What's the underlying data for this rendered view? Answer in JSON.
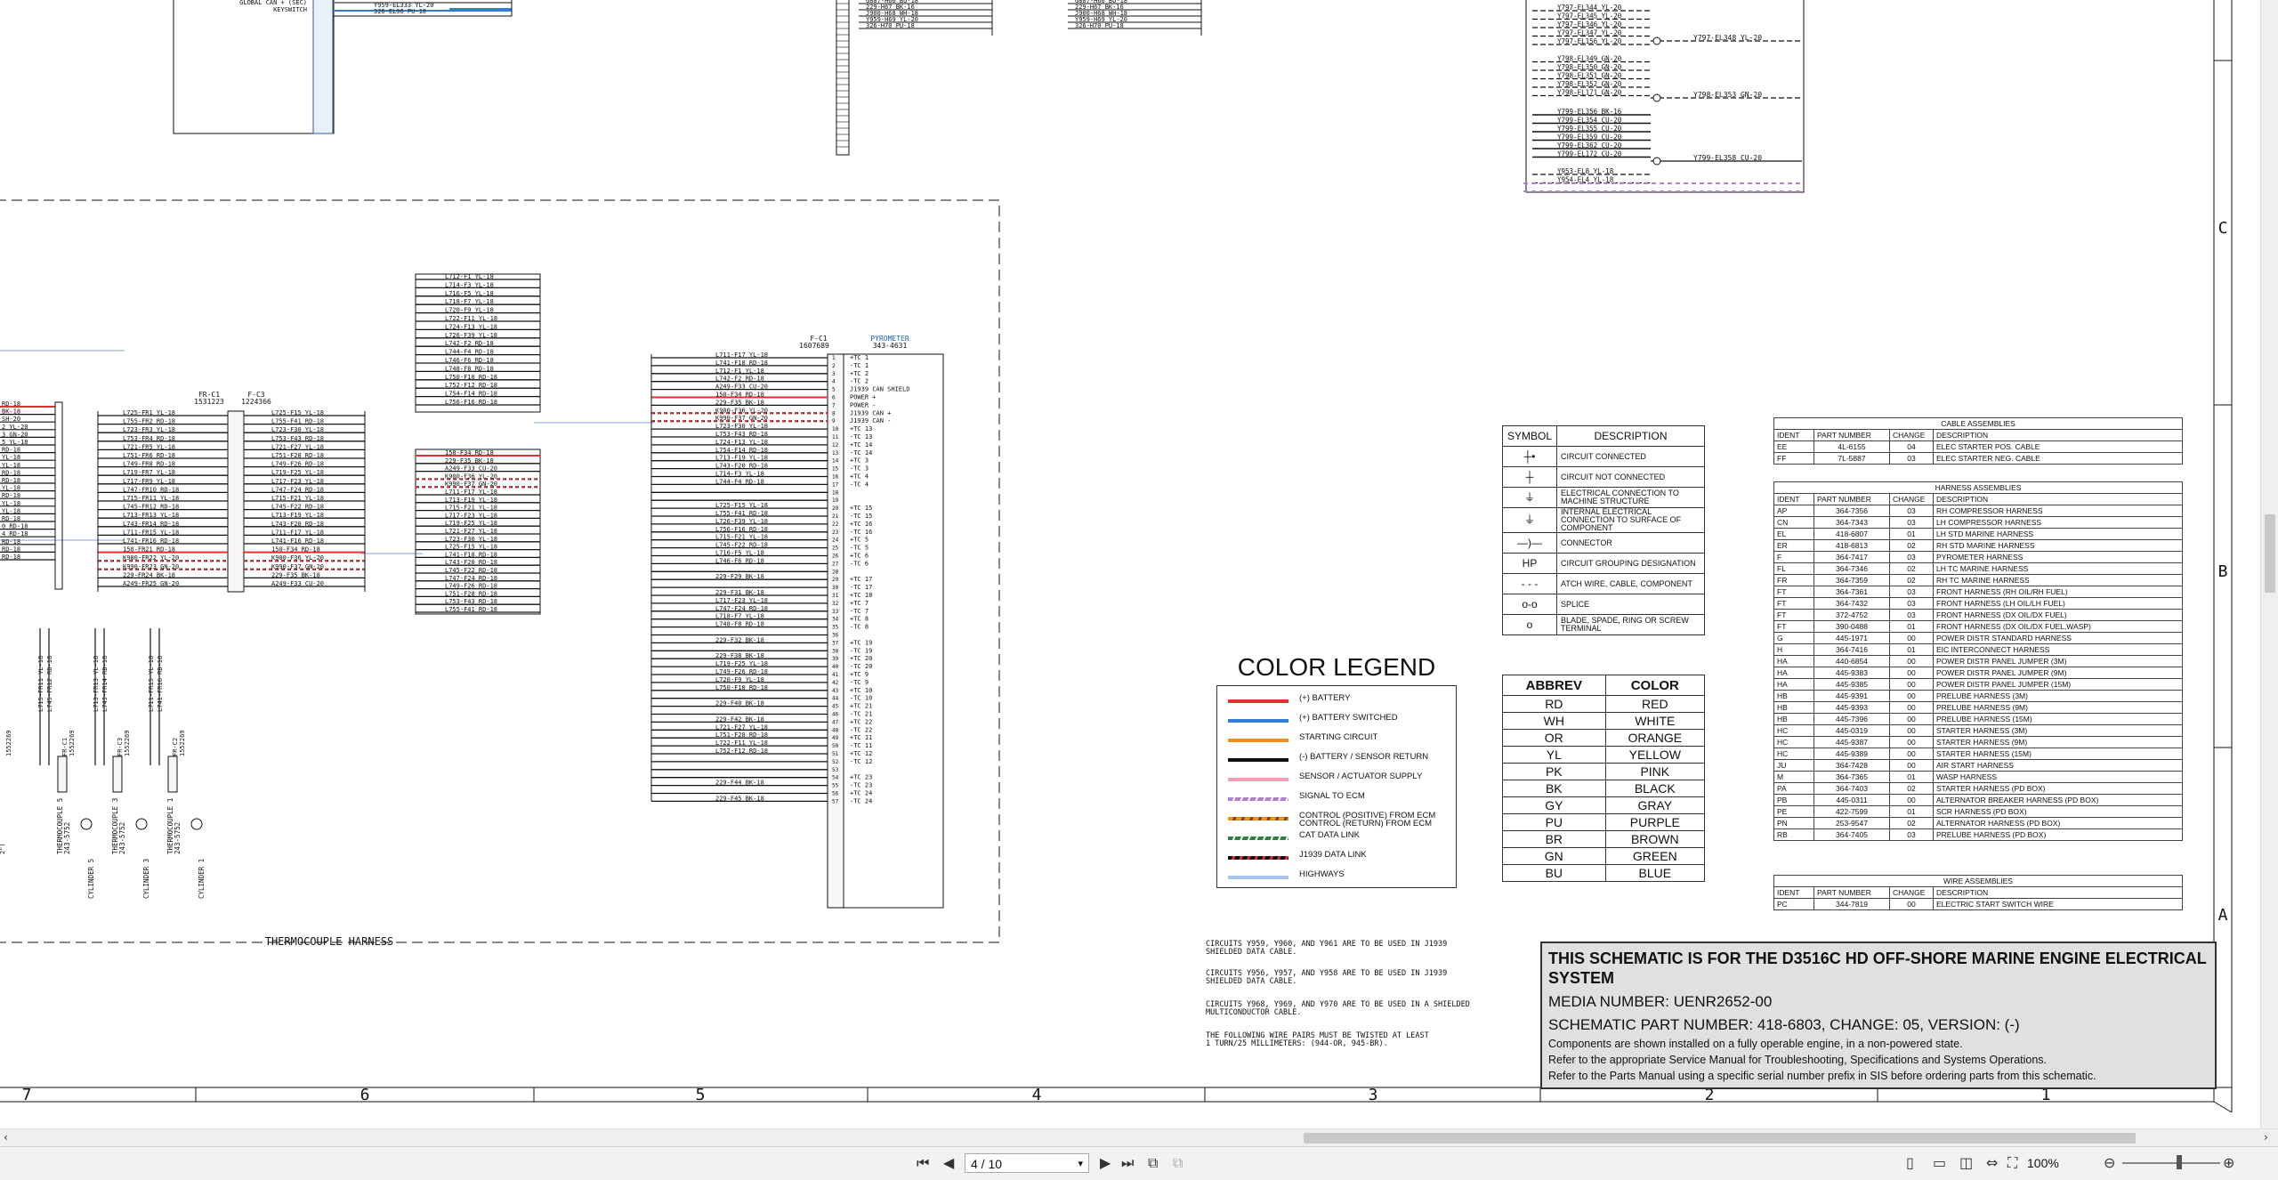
{
  "schematic": {
    "top_left_labels": [
      "GLOBAL CAN + (SEC)",
      "KEYSWITCH"
    ],
    "top_left_wires": [
      "Y959-EL333 YL-20",
      "326-EL96 PU-18"
    ],
    "top_mid_wires_a": [
      "G807-H66 BU-18",
      "229-H67 BK-16",
      "J900-H68 WH-18",
      "Y959-H69 YL-20",
      "326-H70 PU-18"
    ],
    "top_mid_wires_b": [
      "G807-H66 BU-18",
      "229-H67 BK-16",
      "J900-H68 WH-18",
      "Y959-H69 YL-20",
      "326-H70 PU-18"
    ],
    "top_right_wires": [
      "Y797-EL344 YL-20",
      "Y797-EL345 YL-20",
      "Y797-EL346 YL-20",
      "Y797-EL347 YL-20",
      "Y797-EL156 YL-20",
      "Y798-EL349 GN-20",
      "Y798-EL350 GN-20",
      "Y798-EL351 GN-20",
      "Y798-EL352 GN-20",
      "Y798-EL171 GN-20",
      "Y799-EL356 BK-16",
      "Y799-EL354 CU-20",
      "Y799-EL355 CU-20",
      "Y799-EL359 CU-20",
      "Y799-EL362 CU-20",
      "Y799-EL172 CU-20",
      "Y953-EL8 YL-18",
      "Y954-EL4 YL-18"
    ],
    "top_right_splices": [
      "Y797-EL348 YL-20",
      "Y798-EL353 GN-20",
      "Y799-EL358 CU-20"
    ],
    "connector_fr": {
      "name": "FR-C1",
      "part": "1531223"
    },
    "connector_f3": {
      "name": "F-C3",
      "part": "1224366"
    },
    "connector_fc1": {
      "name": "F-C1",
      "part": "1607689"
    },
    "pyrometer": {
      "name": "PYROMETER",
      "part": "343-4631"
    },
    "fr_left_wires": [
      "L725-FR1 YL-18",
      "L755-FR2 RD-18",
      "L723-FR3 YL-18",
      "L753-FR4 RD-18",
      "L721-FR5 YL-18",
      "L751-FR6 RD-18",
      "L749-FR8 RD-18",
      "L719-FR7 YL-18",
      "L717-FR9 YL-18",
      "L747-FR10 RD-18",
      "L715-FR11 YL-18",
      "L745-FR12 RD-18",
      "L713-FR13 YL-18",
      "L743-FR14 RD-18",
      "L711-FR15 YL-18",
      "L741-FR16 RD-18",
      "150-FR21 RD-18",
      "K900-FR22 YL-20",
      "K990-FR23 GN-20",
      "229-FR24 BK-18",
      "A249-FR25 GN-20"
    ],
    "fr_right_wires": [
      "L725-F15 YL-18",
      "L755-F41 RD-18",
      "L723-F30 YL-18",
      "L753-F43 RD-18",
      "L721-F27 YL-18",
      "L751-F28 RD-18",
      "L749-F26 RD-18",
      "L719-F25 YL-18",
      "L717-F23 YL-18",
      "L747-F24 RD-18",
      "L715-F21 YL-18",
      "L745-F22 RD-18",
      "L713-F19 YL-18",
      "L743-F20 RD-18",
      "L711-F17 YL-18",
      "L741-F16 RD-18",
      "150-F34 RD-18",
      "K900-F36 YL-20",
      "K990-F37 GN-20",
      "229-F35 BK-18",
      "A249-F33 CU-20"
    ],
    "mid_wires_a": [
      "L712-F1 YL-18",
      "L714-F3 YL-18",
      "L716-F5 YL-18",
      "L718-F7 YL-18",
      "L720-F9 YL-18",
      "L722-F11 YL-18",
      "L724-F13 YL-18",
      "L726-F39 YL-18",
      "L742-F2 RD-18",
      "L744-F4 RD-18",
      "L746-F6 RD-18",
      "L748-F8 RD-18",
      "L750-F10 RD-18",
      "L752-F12 RD-18",
      "L754-F14 RD-18",
      "L756-F16 RD-18"
    ],
    "mid_wires_b": [
      "150-F34 RD-18",
      "229-F35 BK-18",
      "A249-F33 CU-20",
      "K900-F36 YL-20",
      "K990-F37 GN-20",
      "L711-F17 YL-18",
      "L713-F19 YL-18",
      "L715-F21 YL-18",
      "L717-F23 YL-18",
      "L719-F25 YL-18",
      "L721-F27 YL-18",
      "L723-F30 YL-18",
      "L725-F15 YL-18",
      "L741-F18 RD-18",
      "L743-F20 RD-18",
      "L745-F22 RD-18",
      "L747-F24 RD-18",
      "L749-F26 RD-18",
      "L751-F28 RD-18",
      "L753-F43 RD-18",
      "L755-F41 RD-18"
    ],
    "fc1_wires": [
      "L711-F17 YL-18",
      "L741-F18 RD-18",
      "L712-F1 YL-18",
      "L742-F2 RD-18",
      "A249-F33 CU-20",
      "150-F34 RD-18",
      "229-F35 BK-18",
      "K900-F36 YL-20",
      "K990-F37 GN-20",
      "L723-F30 YL-18",
      "L753-F43 RD-18",
      "L724-F13 YL-18",
      "L754-F14 RD-18",
      "L713-F19 YL-18",
      "L743-F20 RD-18",
      "L714-F3 YL-18",
      "L744-F4 RD-18",
      "",
      "",
      "L725-F15 YL-18",
      "L755-F41 RD-18",
      "L726-F39 YL-18",
      "L756-F16 RD-18",
      "L715-F21 YL-18",
      "L745-F22 RD-18",
      "L716-F5 YL-18",
      "L746-F6 RD-18",
      "",
      "229-F29 BK-18",
      "",
      "229-F31 BK-18",
      "L717-F23 YL-18",
      "L747-F24 RD-18",
      "L718-F7 YL-18",
      "L748-F8 RD-18",
      "",
      "229-F32 BK-18",
      "",
      "229-F38 BK-18",
      "L719-F25 YL-18",
      "L749-F26 RD-18",
      "L720-F9 YL-18",
      "L750-F10 RD-18",
      "",
      "229-F40 BK-18",
      "",
      "229-F42 BK-18",
      "L721-F27 YL-18",
      "L751-F28 RD-18",
      "L722-F11 YL-18",
      "L752-F12 RD-18",
      "",
      "",
      "",
      "229-F44 BK-18",
      "",
      "229-F45 BK-18"
    ],
    "fc1_pin_labels": [
      "+TC 1",
      "-TC 1",
      "+TC 2",
      "-TC 2",
      "J1939 CAN SHIELD",
      "POWER +",
      "POWER -",
      "J1939 CAN +",
      "J1939 CAN -",
      "+TC 13",
      "-TC 13",
      "+TC 14",
      "-TC 14",
      "+TC 3",
      "-TC 3",
      "+TC 4",
      "-TC 4",
      "",
      "",
      "+TC 15",
      "-TC 15",
      "+TC 16",
      "-TC 16",
      "+TC 5",
      "-TC 5",
      "+TC 6",
      "-TC 6",
      "",
      "+TC 17",
      "-TC 17",
      "+TC 18",
      "+TC 7",
      "-TC 7",
      "+TC 8",
      "-TC 8",
      "",
      "+TC 19",
      "-TC 19",
      "+TC 20",
      "-TC 20",
      "+TC 9",
      "-TC 9",
      "+TC 10",
      "-TC 10",
      "+TC 21",
      "-TC 21",
      "+TC 22",
      "-TC 22",
      "+TC 11",
      "-TC 11",
      "+TC 12",
      "-TC 12",
      "",
      "+TC 23",
      "-TC 23",
      "+TC 24",
      "-TC 24"
    ],
    "left_wires": [
      "RD-18",
      "BK-18",
      "SH-20",
      "2 YL-20",
      "3 GN-20",
      "5 YL-18",
      "RD-18",
      "YL-18",
      "YL-18",
      "RD-18",
      "RD-18",
      "YL-18",
      "RD-18",
      "YL-18",
      "YL-18",
      "RD-18",
      "0 RD-18",
      "4 RD-18",
      "RD-18",
      "RD-18",
      "RD-18"
    ],
    "thermocouples": [
      {
        "name": "THERMOCOUPLE 5",
        "part": "243-5752",
        "cyl": "CYLINDER 5",
        "conn": "FR-C1",
        "conn_part": "1552269",
        "wires": [
          "L715-FR11 YL-18",
          "L745-FR12 RD-18"
        ]
      },
      {
        "name": "THERMOCOUPLE 3",
        "part": "243-5752",
        "cyl": "CYLINDER 3",
        "conn": "FR-C3",
        "conn_part": "1552269",
        "wires": [
          "L713-FR13 YL-18",
          "L743-FR14 RD-18"
        ]
      },
      {
        "name": "THERMOCOUPLE 1",
        "part": "243-5752",
        "cyl": "CYLINDER 1",
        "conn": "FR-C2",
        "conn_part": "1552269",
        "wires": [
          "L711-FR15 YL-18",
          "L741-FR16 RD-18"
        ]
      }
    ],
    "left_cut_labels": [
      "2\")",
      "1552269"
    ],
    "harness_label": "THERMOCOUPLE HARNESS"
  },
  "zones": {
    "columns": [
      "7",
      "6",
      "5",
      "4",
      "3",
      "2",
      "1"
    ],
    "rows": [
      "C",
      "B",
      "A"
    ]
  },
  "colors": {
    "battery": "#e03030",
    "battery_switched": "#2f7fd6",
    "starting": "#f0901c",
    "return": "#111111",
    "sensor_supply": "#f4a0b4",
    "signal": "#b080d0",
    "cat_data": "#2f7f3f",
    "highways": "#a8c4e8",
    "title_bg": "#e0e0e0"
  },
  "symbol_table": {
    "headers": [
      "SYMBOL",
      "DESCRIPTION"
    ],
    "rows": [
      {
        "icon": "circuit-connected-icon",
        "glyph": "┼•",
        "desc": "CIRCUIT CONNECTED"
      },
      {
        "icon": "circuit-not-connected-icon",
        "glyph": "┼",
        "desc": "CIRCUIT NOT CONNECTED"
      },
      {
        "icon": "ground-machine-icon",
        "glyph": "⏚",
        "desc": "ELECTRICAL CONNECTION TO MACHINE STRUCTURE"
      },
      {
        "icon": "ground-component-icon",
        "glyph": "⏚",
        "desc": "INTERNAL ELECTRICAL CONNECTION TO SURFACE OF COMPONENT"
      },
      {
        "icon": "connector-icon",
        "glyph": "—)—",
        "desc": "CONNECTOR"
      },
      {
        "icon": "circuit-grouping-icon",
        "glyph": "HP",
        "desc": "CIRCUIT GROUPING DESIGNATION"
      },
      {
        "icon": "attach-wire-icon",
        "glyph": "- - -",
        "desc": "ATCH WIRE, CABLE, COMPONENT"
      },
      {
        "icon": "splice-icon",
        "glyph": "o-o",
        "desc": "SPLICE"
      },
      {
        "icon": "terminal-icon",
        "glyph": "o",
        "desc": "BLADE, SPADE, RING OR SCREW TERMINAL"
      }
    ]
  },
  "abbrev_table": {
    "headers": [
      "ABBREV",
      "COLOR"
    ],
    "rows": [
      [
        "RD",
        "RED"
      ],
      [
        "WH",
        "WHITE"
      ],
      [
        "OR",
        "ORANGE"
      ],
      [
        "YL",
        "YELLOW"
      ],
      [
        "PK",
        "PINK"
      ],
      [
        "BK",
        "BLACK"
      ],
      [
        "GY",
        "GRAY"
      ],
      [
        "PU",
        "PURPLE"
      ],
      [
        "BR",
        "BROWN"
      ],
      [
        "GN",
        "GREEN"
      ],
      [
        "BU",
        "BLUE"
      ]
    ]
  },
  "color_legend": {
    "title": "COLOR LEGEND",
    "items": [
      {
        "label": "(+) BATTERY",
        "style": "battery"
      },
      {
        "label": "(+) BATTERY SWITCHED",
        "style": "battery_switched"
      },
      {
        "label": "STARTING CIRCUIT",
        "style": "starting"
      },
      {
        "label": "(-) BATTERY / SENSOR RETURN",
        "style": "return"
      },
      {
        "label": "SENSOR / ACTUATOR SUPPLY",
        "style": "sensor_supply"
      },
      {
        "label": "SIGNAL TO ECM",
        "style": "signal_dash"
      },
      {
        "label": "CONTROL (POSITIVE) FROM ECM\nCONTROL (RETURN) FROM ECM",
        "style": "control"
      },
      {
        "label": "CAT DATA LINK",
        "style": "cat_dash"
      },
      {
        "label": "J1939 DATA LINK",
        "style": "j1939_dash"
      },
      {
        "label": "HIGHWAYS",
        "style": "highways"
      }
    ]
  },
  "cable_table": {
    "title": "CABLE ASSEMBLIES",
    "headers": [
      "IDENT",
      "PART NUMBER",
      "CHANGE",
      "DESCRIPTION"
    ],
    "rows": [
      [
        "EE",
        "4L-6155",
        "04",
        "ELEC STARTER POS. CABLE"
      ],
      [
        "FF",
        "7L-5887",
        "03",
        "ELEC STARTER NEG. CABLE"
      ]
    ]
  },
  "harness_table": {
    "title": "HARNESS ASSEMBLIES",
    "headers": [
      "IDENT",
      "PART NUMBER",
      "CHANGE",
      "DESCRIPTION"
    ],
    "rows": [
      [
        "AP",
        "364-7356",
        "03",
        "RH COMPRESSOR HARNESS"
      ],
      [
        "CN",
        "364-7343",
        "03",
        "LH COMPRESSOR HARNESS"
      ],
      [
        "EL",
        "418-6807",
        "01",
        "LH STD MARINE HARNESS"
      ],
      [
        "ER",
        "418-6813",
        "02",
        "RH STD MARINE HARNESS"
      ],
      [
        "F",
        "364-7417",
        "03",
        "PYROMETER HARNESS"
      ],
      [
        "FL",
        "364-7346",
        "02",
        "LH TC MARINE HARNESS"
      ],
      [
        "FR",
        "364-7359",
        "02",
        "RH TC MARINE HARNESS"
      ],
      [
        "FT",
        "364-7361",
        "03",
        "FRONT HARNESS (RH OIL/RH FUEL)"
      ],
      [
        "FT",
        "364-7432",
        "03",
        "FRONT HARNESS (LH OIL/LH FUEL)"
      ],
      [
        "FT",
        "372-4752",
        "03",
        "FRONT HARNESS (DX OIL/DX FUEL)"
      ],
      [
        "FT",
        "390-0488",
        "01",
        "FRONT HARNESS (DX OIL/DX FUEL,WASP)"
      ],
      [
        "G",
        "445-1971",
        "00",
        "POWER DISTR STANDARD HARNESS"
      ],
      [
        "H",
        "364-7416",
        "01",
        "EIC INTERCONNECT HARNESS"
      ],
      [
        "HA",
        "440-6854",
        "00",
        "POWER DISTR PANEL JUMPER (3M)"
      ],
      [
        "HA",
        "445-9383",
        "00",
        "POWER DISTR PANEL JUMPER (9M)"
      ],
      [
        "HA",
        "445-9385",
        "00",
        "POWER DISTR PANEL JUMPER (15M)"
      ],
      [
        "HB",
        "445-9391",
        "00",
        "PRELUBE HARNESS (3M)"
      ],
      [
        "HB",
        "445-9393",
        "00",
        "PRELUBE HARNESS (9M)"
      ],
      [
        "HB",
        "445-7396",
        "00",
        "PRELUBE HARNESS (15M)"
      ],
      [
        "HC",
        "445-0319",
        "00",
        "STARTER HARNESS (3M)"
      ],
      [
        "HC",
        "445-9387",
        "00",
        "STARTER HARNESS (9M)"
      ],
      [
        "HC",
        "445-9389",
        "00",
        "STARTER HARNESS (15M)"
      ],
      [
        "JU",
        "364-7428",
        "00",
        "AIR START HARNESS"
      ],
      [
        "M",
        "364-7365",
        "01",
        "WASP HARNESS"
      ],
      [
        "PA",
        "364-7403",
        "02",
        "STARTER HARNESS (PD BOX)"
      ],
      [
        "PB",
        "445-0311",
        "00",
        "ALTERNATOR BREAKER HARNESS (PD BOX)"
      ],
      [
        "PE",
        "422-7599",
        "01",
        "SCR HARNESS (PD BOX)"
      ],
      [
        "PN",
        "253-9547",
        "02",
        "ALTERNATOR HARNESS (PD BOX)"
      ],
      [
        "RB",
        "364-7405",
        "03",
        "PRELUBE HARNESS (PD BOX)"
      ]
    ]
  },
  "wire_table": {
    "title": "WIRE ASSEMBLIES",
    "headers": [
      "IDENT",
      "PART NUMBER",
      "CHANGE",
      "DESCRIPTION"
    ],
    "rows": [
      [
        "PC",
        "344-7819",
        "00",
        "ELECTRIC START SWITCH WIRE"
      ]
    ]
  },
  "notes": [
    "CIRCUITS Y959, Y960, AND Y961 ARE TO BE USED IN J1939\nSHIELDED DATA CABLE.",
    "CIRCUITS Y956, Y957, AND Y958 ARE TO BE USED IN J1939\nSHIELDED DATA CABLE.",
    "CIRCUITS Y968, Y969, AND Y970 ARE TO BE USED IN A SHIELDED\nMULTICONDUCTOR CABLE.",
    "THE FOLLOWING WIRE PAIRS MUST BE TWISTED AT LEAST\n1 TURN/25 MILLIMETERS: (944-OR, 945-BR)."
  ],
  "title_block": {
    "title": "THIS SCHEMATIC IS FOR THE D3516C HD OFF-SHORE MARINE ENGINE ELECTRICAL SYSTEM",
    "media": "MEDIA NUMBER: UENR2652-00",
    "part": "SCHEMATIC PART NUMBER: 418-6803, CHANGE: 05, VERSION: (-)",
    "note1": "Components are shown installed on a fully operable engine, in a non-powered state.",
    "note2": "Refer to the appropriate Service Manual for Troubleshooting, Specifications and Systems Operations.",
    "note3": "Refer to the Parts Manual using a specific serial number prefix in SIS before ordering parts from this schematic."
  },
  "toolbar": {
    "first": "⏮",
    "prev": "◀",
    "page": "4 / 10",
    "page_dropdown": "▾",
    "next": "▶",
    "last": "⏭",
    "zoom": "100%",
    "zoom_out": "⊖",
    "zoom_in": "⊕"
  }
}
